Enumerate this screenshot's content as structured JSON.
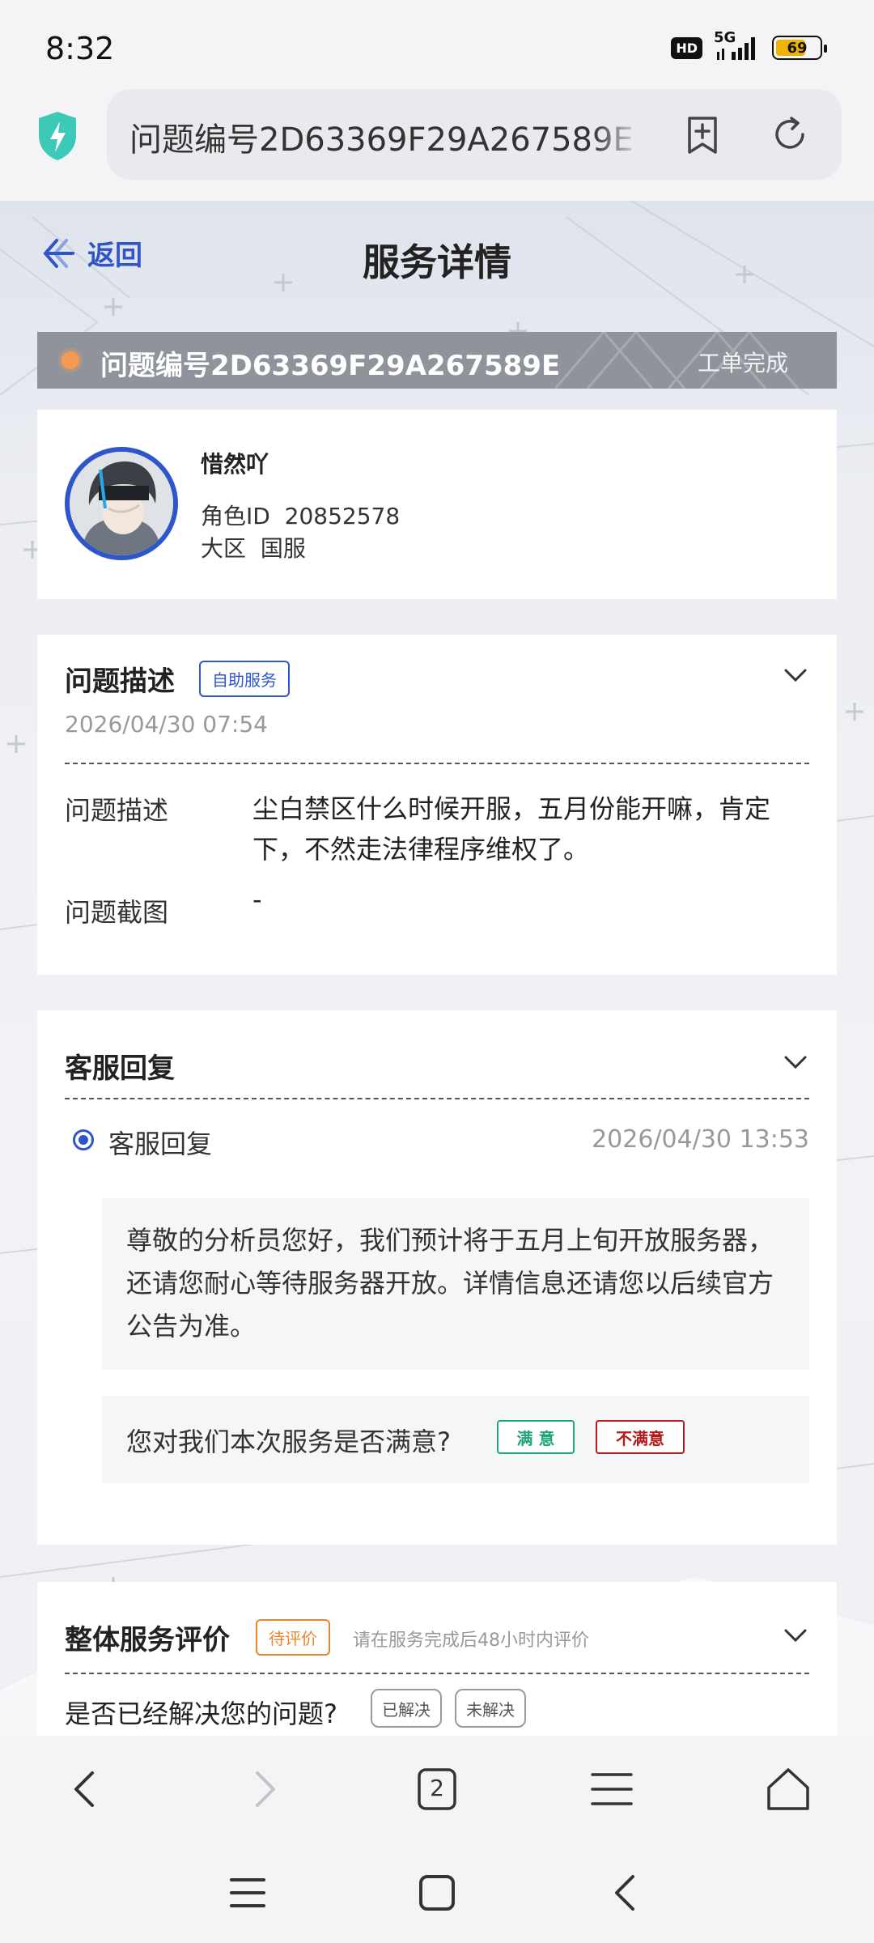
{
  "status_bar": {
    "time": "8:32",
    "hd": "HD",
    "network": "5G",
    "battery": "69",
    "battery_level": 0.69
  },
  "browser": {
    "url_text": "问题编号2D63369F29A267589E",
    "icons": {
      "security": "shield-bolt-icon",
      "bookmark": "bookmark-add-icon",
      "reload": "reload-icon"
    }
  },
  "header": {
    "back_label": "返回",
    "title": "服务详情"
  },
  "ticket": {
    "id_label": "问题编号2D63369F29A267589E",
    "status": "工单完成"
  },
  "profile": {
    "nickname": "惜然吖",
    "role_id_label": "角色ID",
    "role_id": "20852578",
    "region_label": "大区",
    "region": "国服"
  },
  "description": {
    "title": "问题描述",
    "tag": "自助服务",
    "date": "2026/04/30 07:54",
    "desc_label": "问题描述",
    "desc_value": "尘白禁区什么时候开服，五月份能开嘛，肯定下，不然走法律程序维权了。",
    "screenshot_label": "问题截图",
    "screenshot_value": "-"
  },
  "reply": {
    "title": "客服回复",
    "item_label": "客服回复",
    "item_date": "2026/04/30 13:53",
    "text": "尊敬的分析员您好，我们预计将于五月上旬开放服务器，还请您耐心等待服务器开放。详情信息还请您以后续官方公告为准。",
    "satisfaction_question": "您对我们本次服务是否满意?",
    "satisfied": "满 意",
    "unsatisfied": "不满意"
  },
  "evaluation": {
    "title": "整体服务评价",
    "tag": "待评价",
    "hint": "请在服务完成后48小时内评价",
    "question": "是否已经解决您的问题?",
    "resolved": "已解决",
    "unresolved": "未解决"
  },
  "browser_nav": {
    "tab_count": "2",
    "icons": [
      "back-icon",
      "forward-icon",
      "tabs-icon",
      "menu-icon",
      "home-icon"
    ]
  },
  "system_nav": {
    "icons": [
      "recents-icon",
      "home-icon",
      "back-icon"
    ]
  },
  "colors": {
    "accent_blue": "#2f56c9",
    "ticket_bar": "#8e939c",
    "satisfied_green": "#1fa57a",
    "unsatisfied_red": "#b31b1b",
    "pending_orange": "#e8862c"
  }
}
